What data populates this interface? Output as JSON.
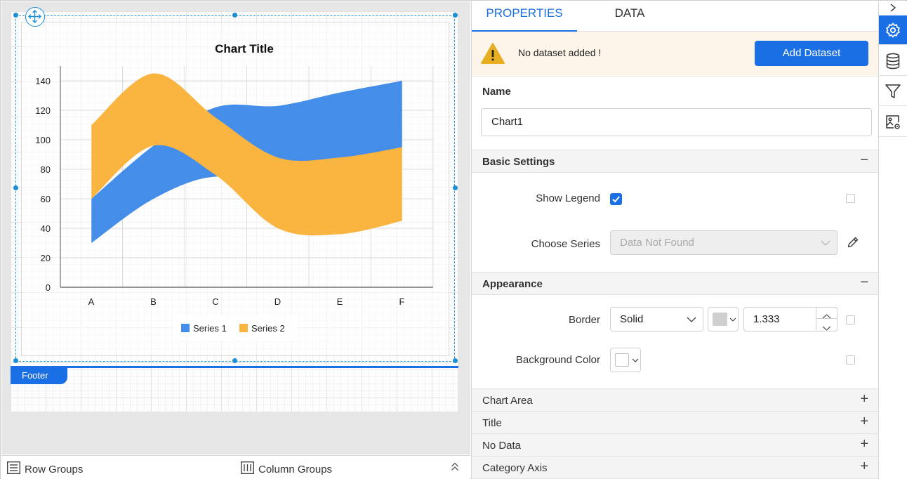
{
  "report": {
    "footer_label": "Footer"
  },
  "chart_data": {
    "type": "area",
    "title": "Chart Title",
    "categories": [
      "A",
      "B",
      "C",
      "D",
      "E",
      "F"
    ],
    "yticks": [
      "0",
      "20",
      "40",
      "60",
      "80",
      "100",
      "120",
      "140"
    ],
    "ylim": [
      0,
      150
    ],
    "series": [
      {
        "name": "Series 1",
        "color": "#448ee9",
        "low": [
          30,
          60,
          75,
          65,
          70,
          95
        ],
        "high": [
          60,
          96,
          122,
          123,
          132,
          140
        ]
      },
      {
        "name": "Series 2",
        "color": "#fab440",
        "low": [
          60,
          96,
          76,
          40,
          36,
          45
        ],
        "high": [
          110,
          145,
          115,
          88,
          88,
          95
        ]
      }
    ],
    "legend_position": "bottom",
    "grid": true
  },
  "bottom_bar": {
    "row_groups": "Row Groups",
    "column_groups": "Column Groups"
  },
  "panel": {
    "tabs": [
      "PROPERTIES",
      "DATA"
    ],
    "notice": "No dataset added !",
    "add_dataset": "Add Dataset",
    "name_label": "Name",
    "name_value": "Chart1",
    "basic_settings": "Basic Settings",
    "show_legend": "Show Legend",
    "choose_series": "Choose Series",
    "choose_series_value": "Data Not Found",
    "appearance": "Appearance",
    "border_label": "Border",
    "border_style": "Solid",
    "border_width": "1.333",
    "background_color_label": "Background Color",
    "collapsed_sections": [
      "Chart Area",
      "Title",
      "No Data",
      "Category Axis"
    ]
  },
  "toolbar": {
    "items": [
      "settings-icon",
      "database-icon",
      "filter-icon",
      "image-settings-icon"
    ]
  }
}
